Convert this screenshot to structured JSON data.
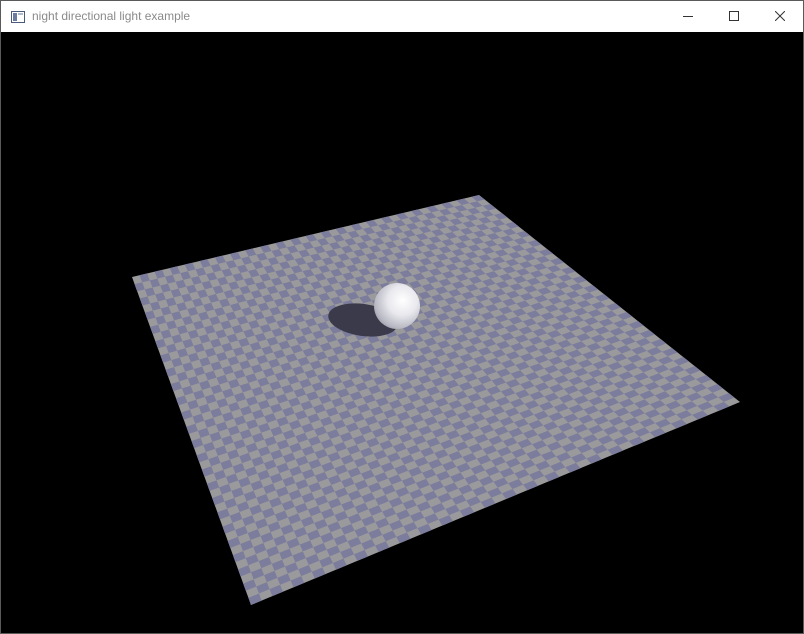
{
  "window": {
    "title": "night directional light example",
    "icon": "app-window-icon",
    "controls": {
      "minimize": "minimize-icon",
      "maximize": "maximize-icon",
      "close": "close-icon"
    }
  },
  "scene": {
    "background_color": "#000000",
    "floor": {
      "pattern": "checkerboard",
      "color_a": "#9a9a9c",
      "color_b": "#7c7c9c"
    },
    "sphere": {
      "color": "#f2f2f4"
    },
    "shadow": {
      "color": "#3a3a4a"
    }
  }
}
